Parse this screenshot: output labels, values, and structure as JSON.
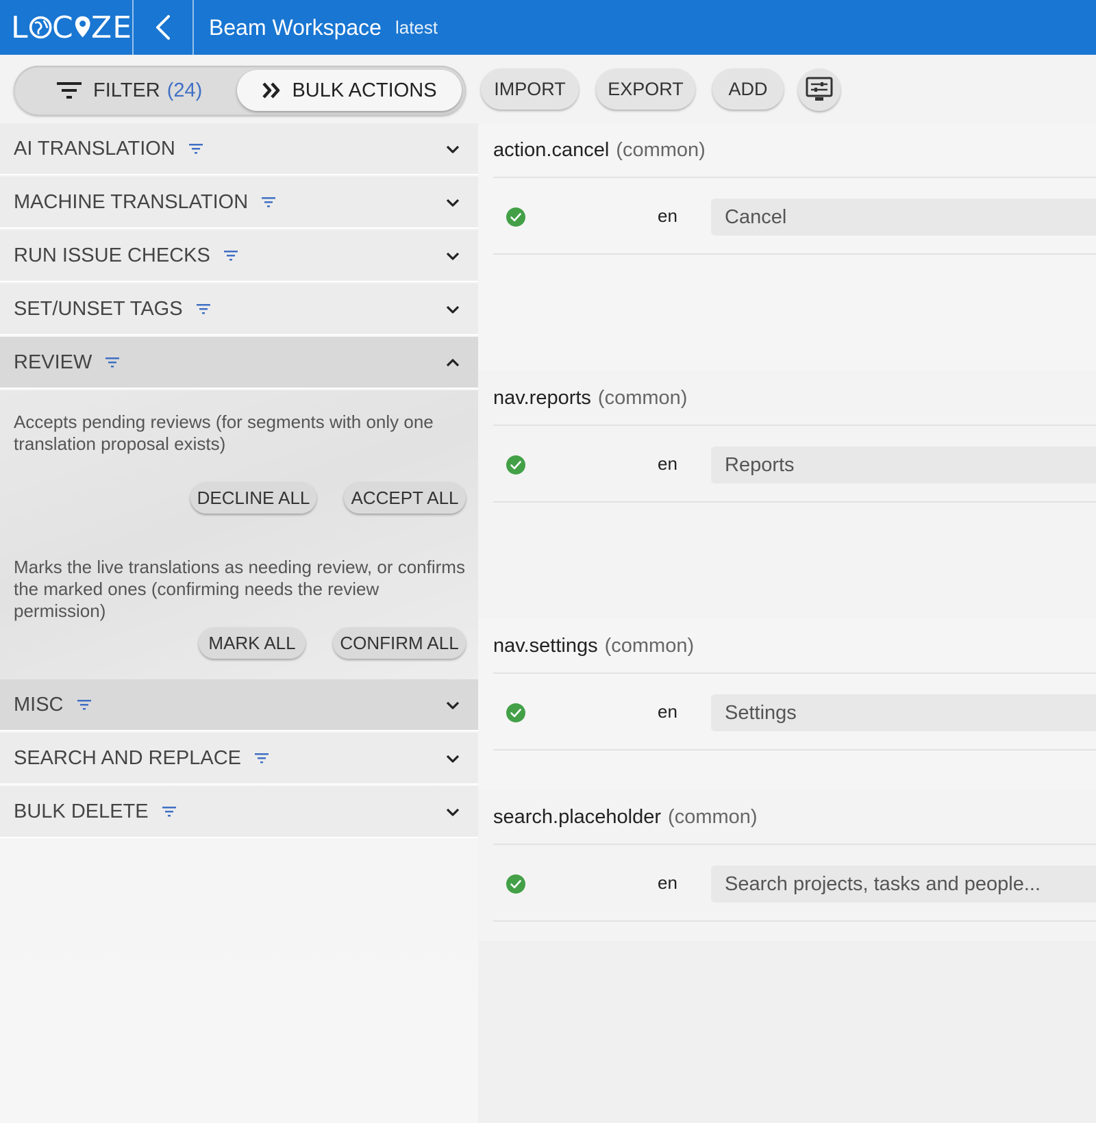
{
  "header": {
    "logo": "LOCIZE",
    "project_title": "Beam Workspace",
    "branch": "latest"
  },
  "toolbar": {
    "filter_label": "FILTER",
    "filter_count": "(24)",
    "bulk_label": "BULK ACTIONS",
    "import_label": "IMPORT",
    "export_label": "EXPORT",
    "add_label": "ADD"
  },
  "sections": [
    {
      "label": "AI TRANSLATION",
      "expanded": false
    },
    {
      "label": "MACHINE TRANSLATION",
      "expanded": false
    },
    {
      "label": "RUN ISSUE CHECKS",
      "expanded": false
    },
    {
      "label": "SET/UNSET TAGS",
      "expanded": false
    },
    {
      "label": "REVIEW",
      "expanded": true
    },
    {
      "label": "MISC",
      "expanded": false
    },
    {
      "label": "SEARCH AND REPLACE",
      "expanded": false
    },
    {
      "label": "BULK DELETE",
      "expanded": false
    }
  ],
  "review": {
    "desc1": "Accepts pending reviews (for segments with only one translation proposal exists)",
    "decline_all": "DECLINE ALL",
    "accept_all": "ACCEPT ALL",
    "desc2": "Marks the live translations as needing review, or confirms the marked ones (confirming needs the review permission)",
    "mark_all": "MARK ALL",
    "confirm_all": "CONFIRM ALL"
  },
  "keys": [
    {
      "key": "action.cancel",
      "ns": "(common)",
      "lang": "en",
      "value": "Cancel"
    },
    {
      "key": "nav.reports",
      "ns": "(common)",
      "lang": "en",
      "value": "Reports"
    },
    {
      "key": "nav.settings",
      "ns": "(common)",
      "lang": "en",
      "value": "Settings"
    },
    {
      "key": "search.placeholder",
      "ns": "(common)",
      "lang": "en",
      "value": "Search projects, tasks and people..."
    }
  ],
  "colors": {
    "brand": "#1976d2",
    "filter_accent": "#3f6fc4",
    "ok_green": "#43a047"
  }
}
